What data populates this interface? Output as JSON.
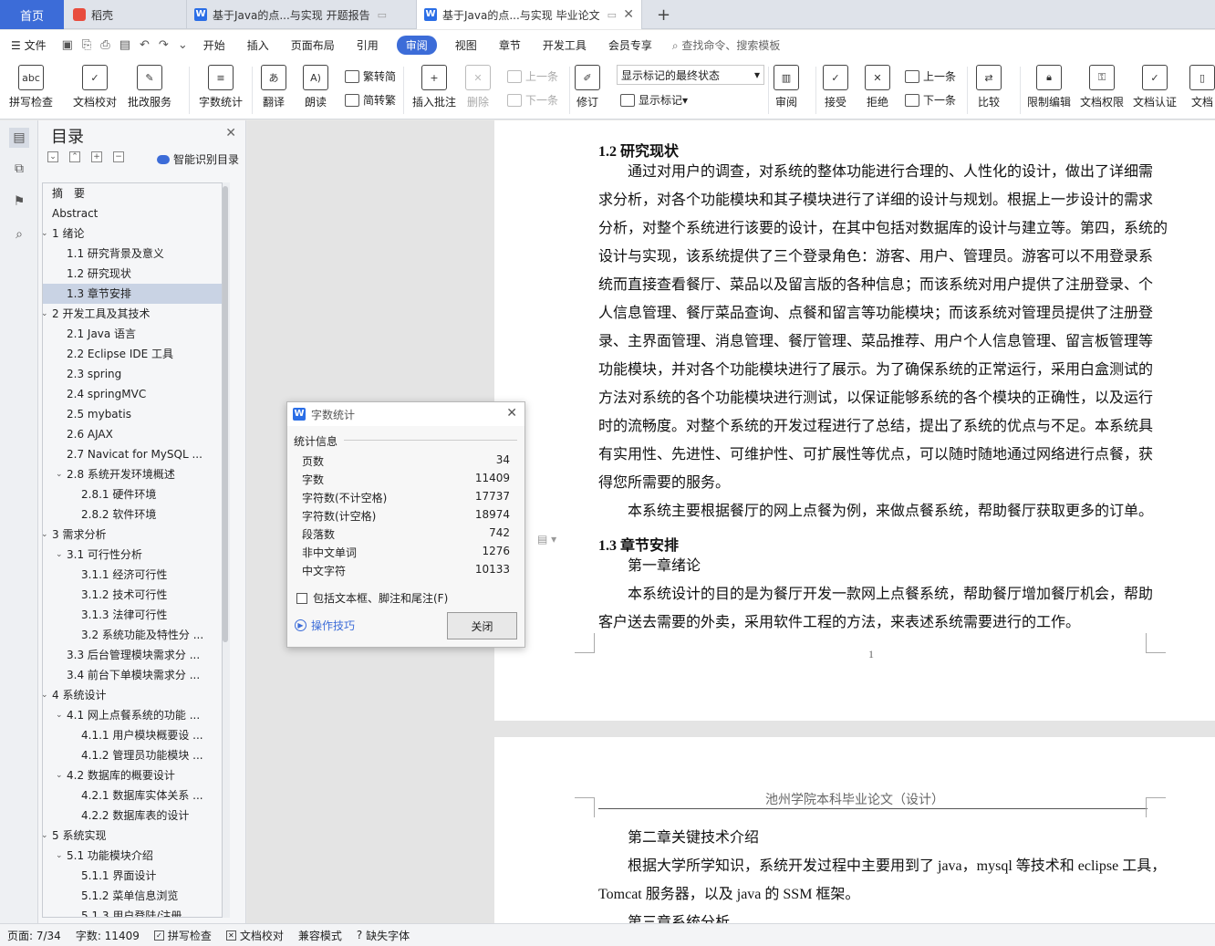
{
  "tabs": {
    "home": "首页",
    "daoke": "稻壳",
    "doc1": "基于Java的点...与实现 开题报告",
    "doc2": "基于Java的点...与实现 毕业论文"
  },
  "menu": {
    "file": "文件",
    "items": [
      "开始",
      "插入",
      "页面布局",
      "引用",
      "审阅",
      "视图",
      "章节",
      "开发工具",
      "会员专享"
    ],
    "search": "查找命令、搜索模板"
  },
  "ribbon": {
    "spell": "拼写检查",
    "doc_check": "文档校对",
    "correction": "批改服务",
    "word_count": "字数统计",
    "translate": "翻译",
    "read_aloud": "朗读",
    "to_traditional": "繁转简",
    "to_simplified": "简转繁",
    "insert_comment": "插入批注",
    "delete": "删除",
    "prev_comment": "上一条",
    "next_comment": "下一条",
    "revise": "修订",
    "mark_state": "显示标记的最终状态",
    "show_marks": "显示标记",
    "review": "审阅",
    "accept": "接受",
    "reject": "拒绝",
    "prev_change": "上一条",
    "next_change": "下一条",
    "compare": "比较",
    "restrict_edit": "限制编辑",
    "doc_rights": "文档权限",
    "doc_cert": "文档认证",
    "doc_more": "文档"
  },
  "toc": {
    "title": "目录",
    "smart": "智能识别目录",
    "items": [
      {
        "text": "摘　要",
        "level": 1,
        "arrow": ""
      },
      {
        "text": "Abstract",
        "level": 1,
        "arrow": ""
      },
      {
        "text": "1  绪论",
        "level": 1,
        "arrow": "v"
      },
      {
        "text": "1.1 研究背景及意义",
        "level": 2,
        "arrow": ""
      },
      {
        "text": "1.2 研究现状",
        "level": 2,
        "arrow": ""
      },
      {
        "text": "1.3 章节安排",
        "level": 2,
        "arrow": "",
        "selected": true
      },
      {
        "text": "2  开发工具及其技术",
        "level": 1,
        "arrow": "v"
      },
      {
        "text": "2.1 Java 语言",
        "level": 2,
        "arrow": ""
      },
      {
        "text": "2.2 Eclipse IDE 工具",
        "level": 2,
        "arrow": ""
      },
      {
        "text": "2.3 spring",
        "level": 2,
        "arrow": ""
      },
      {
        "text": "2.4 springMVC",
        "level": 2,
        "arrow": ""
      },
      {
        "text": "2.5 mybatis",
        "level": 2,
        "arrow": ""
      },
      {
        "text": "2.6 AJAX",
        "level": 2,
        "arrow": ""
      },
      {
        "text": "2.7 Navicat for MySQL ...",
        "level": 2,
        "arrow": ""
      },
      {
        "text": "2.8 系统开发环境概述",
        "level": 2,
        "arrow": "v"
      },
      {
        "text": "2.8.1 硬件环境",
        "level": 3,
        "arrow": ""
      },
      {
        "text": "2.8.2 软件环境",
        "level": 3,
        "arrow": ""
      },
      {
        "text": "3  需求分析",
        "level": 1,
        "arrow": "v"
      },
      {
        "text": "3.1 可行性分析",
        "level": 2,
        "arrow": "v"
      },
      {
        "text": "3.1.1 经济可行性",
        "level": 3,
        "arrow": ""
      },
      {
        "text": "3.1.2 技术可行性",
        "level": 3,
        "arrow": ""
      },
      {
        "text": "3.1.3 法律可行性",
        "level": 3,
        "arrow": ""
      },
      {
        "text": "3.2 系统功能及特性分 ...",
        "level": 3,
        "arrow": ""
      },
      {
        "text": "3.3 后台管理模块需求分 ...",
        "level": 2,
        "arrow": ""
      },
      {
        "text": "3.4 前台下单模块需求分 ...",
        "level": 2,
        "arrow": ""
      },
      {
        "text": "4  系统设计",
        "level": 1,
        "arrow": "v"
      },
      {
        "text": "4.1 网上点餐系统的功能 ...",
        "level": 2,
        "arrow": "v"
      },
      {
        "text": "4.1.1 用户模块概要设 ...",
        "level": 3,
        "arrow": ""
      },
      {
        "text": "4.1.2 管理员功能模块 ...",
        "level": 3,
        "arrow": ""
      },
      {
        "text": "4.2 数据库的概要设计",
        "level": 2,
        "arrow": "v"
      },
      {
        "text": "4.2.1 数据库实体关系 ...",
        "level": 3,
        "arrow": ""
      },
      {
        "text": "4.2.2 数据库表的设计",
        "level": 3,
        "arrow": ""
      },
      {
        "text": "5  系统实现",
        "level": 1,
        "arrow": "v"
      },
      {
        "text": "5.1 功能模块介绍",
        "level": 2,
        "arrow": "v"
      },
      {
        "text": "5.1.1 界面设计",
        "level": 3,
        "arrow": ""
      },
      {
        "text": "5.1.2  菜单信息浏览",
        "level": 3,
        "arrow": ""
      },
      {
        "text": "5.1.3  用户登陆/注册",
        "level": 3,
        "arrow": ""
      }
    ]
  },
  "document": {
    "page1_lines": [
      {
        "text": "1.2 研究现状",
        "heading": true,
        "indent": 0
      },
      {
        "text": "通过对用户的调查，对系统的整体功能进行合理的、人性化的设计，做出了详细需",
        "heading": false,
        "indent": 1
      },
      {
        "text": "求分析，对各个功能模块和其子模块进行了详细的设计与规划。根据上一步设计的需求",
        "heading": false,
        "indent": 0
      },
      {
        "text": "分析，对整个系统进行该要的设计，在其中包括对数据库的设计与建立等。第四，系统的",
        "heading": false,
        "indent": 0
      },
      {
        "text": "设计与实现，该系统提供了三个登录角色：游客、用户、管理员。游客可以不用登录系",
        "heading": false,
        "indent": 0
      },
      {
        "text": "统而直接查看餐厅、菜品以及留言版的各种信息；而该系统对用户提供了注册登录、个",
        "heading": false,
        "indent": 0
      },
      {
        "text": "人信息管理、餐厅菜品查询、点餐和留言等功能模块；而该系统对管理员提供了注册登",
        "heading": false,
        "indent": 0
      },
      {
        "text": "录、主界面管理、消息管理、餐厅管理、菜品推荐、用户个人信息管理、留言板管理等",
        "heading": false,
        "indent": 0
      },
      {
        "text": "功能模块，并对各个功能模块进行了展示。为了确保系统的正常运行，采用白盒测试的",
        "heading": false,
        "indent": 0
      },
      {
        "text": "方法对系统的各个功能模块进行测试，以保证能够系统的各个模块的正确性，以及运行",
        "heading": false,
        "indent": 0
      },
      {
        "text": "时的流畅度。对整个系统的开发过程进行了总结，提出了系统的优点与不足。本系统具",
        "heading": false,
        "indent": 0
      },
      {
        "text": "有实用性、先进性、可维护性、可扩展性等优点，可以随时随地通过网络进行点餐，获",
        "heading": false,
        "indent": 0
      },
      {
        "text": "得您所需要的服务。",
        "heading": false,
        "indent": 0
      },
      {
        "text": "本系统主要根据餐厅的网上点餐为例，来做点餐系统，帮助餐厅获取更多的订单。",
        "heading": false,
        "indent": 1
      },
      {
        "text": "1.3 章节安排",
        "heading": true,
        "indent": 0
      },
      {
        "text": "第一章绪论",
        "heading": false,
        "indent": 1
      },
      {
        "text": "本系统设计的目的是为餐厅开发一款网上点餐系统，帮助餐厅增加餐厅机会，帮助",
        "heading": false,
        "indent": 1
      },
      {
        "text": "客户送去需要的外卖，采用软件工程的方法，来表述系统需要进行的工作。",
        "heading": false,
        "indent": 0
      }
    ],
    "page_number": "1",
    "page2_header": "池州学院本科毕业论文（设计）",
    "page2_lines": [
      {
        "text": "第二章关键技术介绍",
        "indent": 1
      },
      {
        "text": "根据大学所学知识，系统开发过程中主要用到了 java，mysql 等技术和 eclipse 工具，",
        "indent": 1
      },
      {
        "text": "Tomcat 服务器，以及 java 的 SSM 框架。",
        "indent": 0
      },
      {
        "text": "第三章系统分析",
        "indent": 1
      }
    ]
  },
  "dialog": {
    "title": "字数统计",
    "section": "统计信息",
    "stats": [
      {
        "label": "页数",
        "value": "34"
      },
      {
        "label": "字数",
        "value": "11409"
      },
      {
        "label": "字符数(不计空格)",
        "value": "17737"
      },
      {
        "label": "字符数(计空格)",
        "value": "18974"
      },
      {
        "label": "段落数",
        "value": "742"
      },
      {
        "label": "非中文单词",
        "value": "1276"
      },
      {
        "label": "中文字符",
        "value": "10133"
      }
    ],
    "include_label": "包括文本框、脚注和尾注(F)",
    "tips": "操作技巧",
    "close": "关闭"
  },
  "status": {
    "page": "页面: 7/34",
    "words": "字数: 11409",
    "spell": "拼写检查",
    "doc_check": "文档校对",
    "compat": "兼容模式",
    "missing_font": "缺失字体"
  }
}
